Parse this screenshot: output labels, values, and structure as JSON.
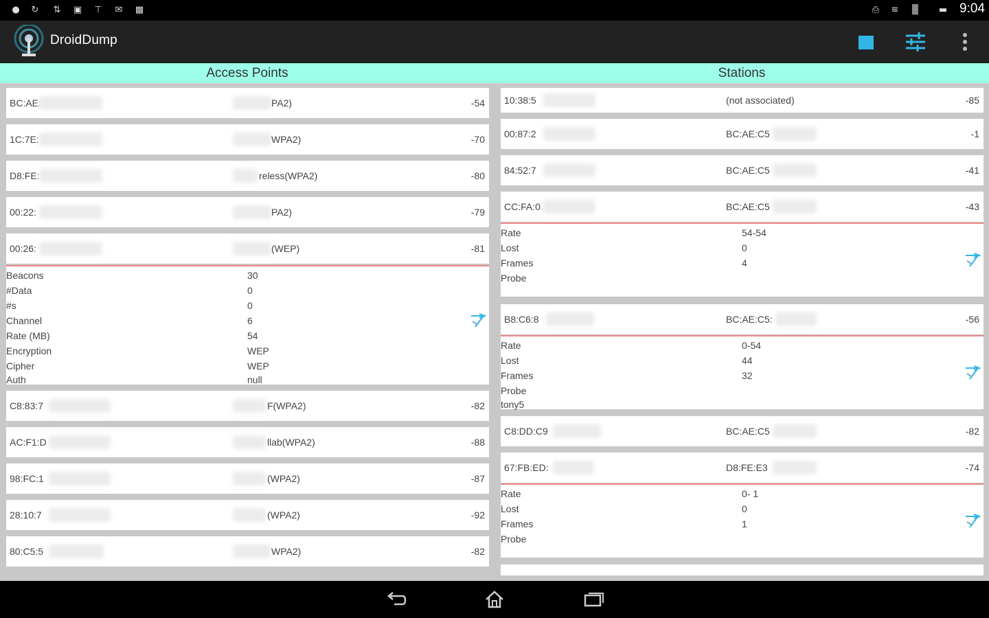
{
  "status": {
    "time": "9:04"
  },
  "app": {
    "title": "DroidDump"
  },
  "headers": {
    "access_points": "Access Points",
    "stations": "Stations"
  },
  "access_points": [
    {
      "mac": "BC:AE:",
      "ssid": "PA2)",
      "signal": "-54"
    },
    {
      "mac": "1C:7E:",
      "ssid": "WPA2)",
      "signal": "-70"
    },
    {
      "mac": "D8:FE:",
      "ssid": "reless(WPA2)",
      "signal": "-80"
    },
    {
      "mac": "00:22:",
      "ssid": "PA2)",
      "signal": "-79"
    },
    {
      "mac": "00:26:",
      "ssid": "(WEP)",
      "signal": "-81"
    },
    {
      "mac": "C8:83:7",
      "ssid": "F(WPA2)",
      "signal": "-82"
    },
    {
      "mac": "AC:F1:D",
      "ssid": "llab(WPA2)",
      "signal": "-88"
    },
    {
      "mac": "98:FC:1",
      "ssid": "(WPA2)",
      "signal": "-87"
    },
    {
      "mac": "28:10:7",
      "ssid": "(WPA2)",
      "signal": "-92"
    },
    {
      "mac": "80:C5:5",
      "ssid": "WPA2)",
      "signal": "-82"
    }
  ],
  "ap_detail": {
    "labels": [
      "Beacons",
      "#Data",
      "#s",
      "Channel",
      "Rate (MB)",
      "Encryption",
      "Cipher",
      "Auth"
    ],
    "values": [
      "30",
      "0",
      "0",
      "6",
      "54",
      "WEP",
      "WEP",
      "null"
    ]
  },
  "stations": [
    {
      "mac": "10:38:5",
      "ap": "(not associated)",
      "signal": "-85"
    },
    {
      "mac": "00:87:2",
      "ap": "BC:AE:C5",
      "signal": "-1"
    },
    {
      "mac": "84:52:7",
      "ap": "BC:AE:C5",
      "signal": "-41"
    },
    {
      "mac": "CC:FA:0",
      "ap": "BC:AE:C5",
      "signal": "-43"
    },
    {
      "mac": "B8:C6:8",
      "ap": "BC:AE:C5:",
      "signal": "-56"
    },
    {
      "mac": "C8:DD:C9",
      "ap": "BC:AE:C5",
      "signal": "-82"
    },
    {
      "mac": "67:FB:ED:",
      "ap": "D8:FE:E3",
      "signal": "-74"
    }
  ],
  "st_details": [
    {
      "labels": [
        "Rate",
        "Lost",
        "Frames",
        "Probe"
      ],
      "values": [
        "54-54",
        "0",
        "4",
        ""
      ]
    },
    {
      "labels": [
        "Rate",
        "Lost",
        "Frames",
        "Probe",
        "tony5"
      ],
      "values": [
        "0-54",
        "44",
        "32",
        "",
        ""
      ]
    },
    {
      "labels": [
        "Rate",
        "Lost",
        "Frames",
        "Probe"
      ],
      "values": [
        "0- 1",
        "0",
        "1",
        ""
      ]
    }
  ],
  "colors": {
    "header_bg": "#9effe9",
    "accent": "#33b5e5",
    "detail_border": "#ee8888"
  }
}
